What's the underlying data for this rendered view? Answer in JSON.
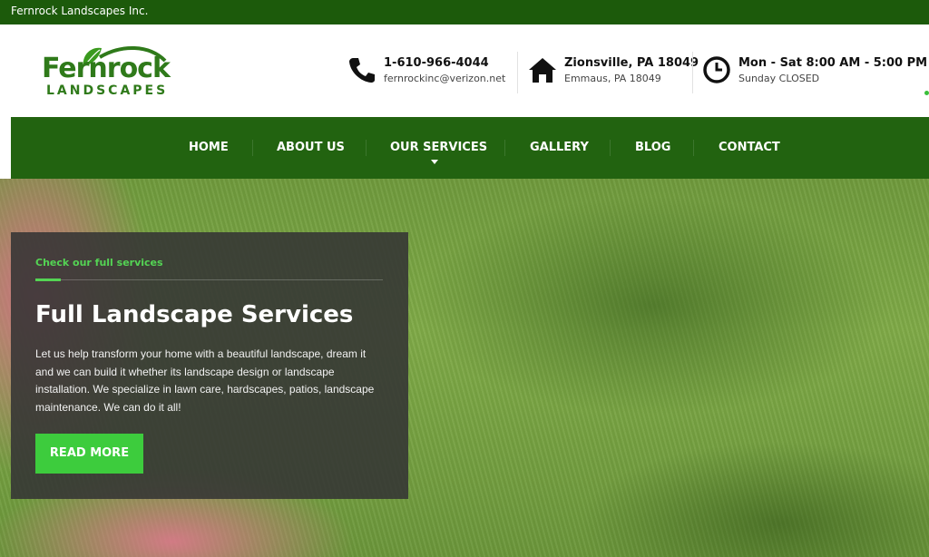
{
  "topbar": {
    "company": "Fernrock Landscapes Inc."
  },
  "logo": {
    "word": "Fernrock",
    "sub": "LANDSCAPES"
  },
  "contact": {
    "phone": {
      "icon": "phone-icon",
      "line1": "1-610-966-4044",
      "line2": "fernrockinc@verizon.net"
    },
    "address": {
      "icon": "home-icon",
      "line1": "Zionsville, PA 18049",
      "line2": "Emmaus, PA 18049"
    },
    "hours": {
      "icon": "clock-icon",
      "line1": "Mon - Sat 8:00 AM - 5:00 PM",
      "line2": "Sunday CLOSED"
    }
  },
  "nav": {
    "items": [
      {
        "label": "HOME"
      },
      {
        "label": "ABOUT US"
      },
      {
        "label": "OUR SERVICES"
      },
      {
        "label": "GALLERY"
      },
      {
        "label": "BLOG"
      },
      {
        "label": "CONTACT"
      }
    ]
  },
  "hero": {
    "tag": "Check our full services",
    "title": "Full Landscape Services",
    "body": "Let us help transform your home with a beautiful landscape, dream it and we can build it whether its landscape design or landscape installation.  We specialize in lawn care, hardscapes, patios, landscape maintenance. We can do it all!",
    "button": "READ MORE"
  },
  "colors": {
    "brand_green": "#1c5a0b",
    "nav_green": "#226310",
    "accent_green": "#3dcc3d"
  }
}
